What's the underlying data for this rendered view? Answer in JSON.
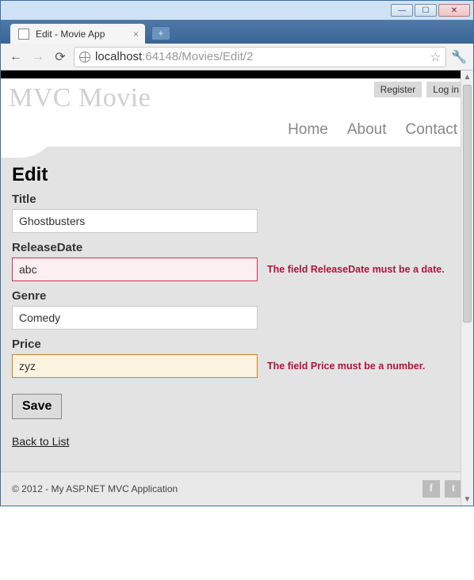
{
  "window": {
    "tab_title": "Edit - Movie App",
    "url_prefix": "localhost",
    "url_rest": ":64148/Movies/Edit/2"
  },
  "header": {
    "logo": "MVC Movie",
    "register": "Register",
    "login": "Log in",
    "nav": {
      "home": "Home",
      "about": "About",
      "contact": "Contact"
    }
  },
  "page": {
    "heading": "Edit",
    "fields": {
      "title": {
        "label": "Title",
        "value": "Ghostbusters"
      },
      "releaseDate": {
        "label": "ReleaseDate",
        "value": "abc",
        "error": "The field ReleaseDate must be a date."
      },
      "genre": {
        "label": "Genre",
        "value": "Comedy"
      },
      "price": {
        "label": "Price",
        "value": "zyz",
        "error": "The field Price must be a number."
      }
    },
    "save_label": "Save",
    "back_label": "Back to List"
  },
  "footer": {
    "copyright": "© 2012 - My ASP.NET MVC Application"
  }
}
